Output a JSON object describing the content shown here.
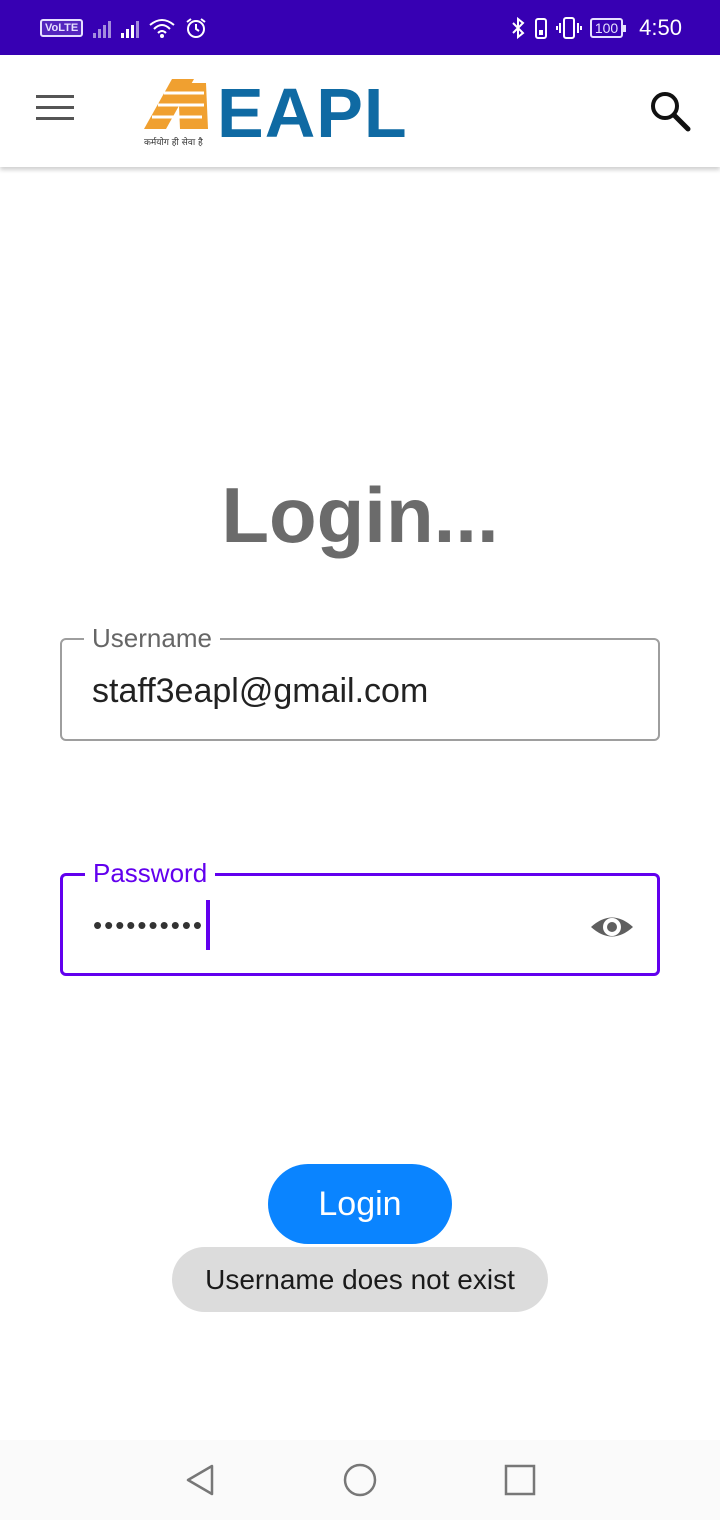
{
  "status_bar": {
    "volte": "VoLTE",
    "battery": "100",
    "time": "4:50"
  },
  "app_bar": {
    "logo_text": "EAPL",
    "logo_tagline": "कर्मयोग ही सेवा है",
    "logo_color": "#0f6aa3",
    "logo_mark_color": "#f0a030"
  },
  "login": {
    "heading": "Login...",
    "username_label": "Username",
    "username_value": "staff3eapl@gmail.com",
    "password_label": "Password",
    "password_value": "••••••••••",
    "button_label": "Login",
    "toast_message": "Username does not exist"
  },
  "colors": {
    "status_bar": "#3700b3",
    "accent": "#6200ee",
    "button": "#0a84ff"
  }
}
